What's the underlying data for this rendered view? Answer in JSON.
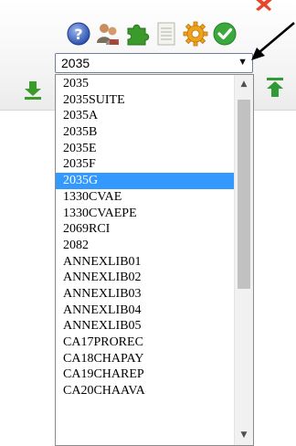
{
  "toolbar": {
    "icons": [
      "help-icon",
      "users-icon",
      "puzzle-icon",
      "document-icon",
      "settings-gear-icon",
      "checkmark-icon"
    ]
  },
  "select": {
    "selected_value": "2035",
    "caret": "▼"
  },
  "dropdown": {
    "highlighted_index": 6,
    "options": [
      "2035",
      "2035SUITE",
      "2035A",
      "2035B",
      "2035E",
      "2035F",
      "2035G",
      "1330CVAE",
      "1330CVAEPE",
      "2069RCI",
      "2082",
      "ANNEXLIB01",
      "ANNEXLIB02",
      "ANNEXLIB03",
      "ANNEXLIB04",
      "ANNEXLIB05",
      "CA17PROREC",
      "CA18CHAPAY",
      "CA19CHAREP",
      "CA20CHAAVA"
    ]
  },
  "scrollbar": {
    "up_glyph": "▲",
    "down_glyph": "▼"
  },
  "colors": {
    "highlight": "#3399ff",
    "download_green": "#3a9a2a",
    "upload_green": "#2f9a36"
  }
}
